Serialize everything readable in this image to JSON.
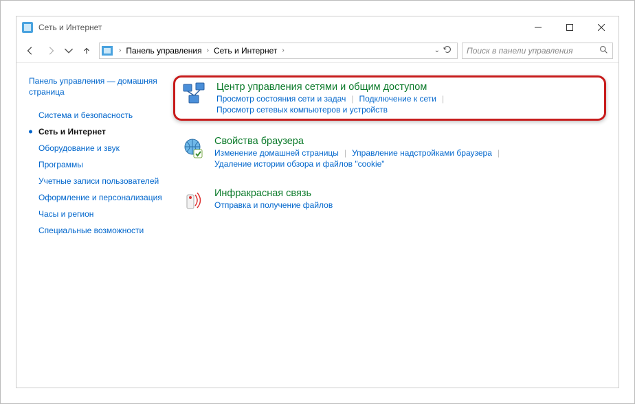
{
  "window": {
    "title": "Сеть и Интернет"
  },
  "breadcrumb": {
    "root": "Панель управления",
    "current": "Сеть и Интернет"
  },
  "search": {
    "placeholder": "Поиск в панели управления"
  },
  "sidebar": {
    "heading": "Панель управления — домашняя страница",
    "items": [
      {
        "label": "Система и безопасность",
        "current": false
      },
      {
        "label": "Сеть и Интернет",
        "current": true
      },
      {
        "label": "Оборудование и звук",
        "current": false
      },
      {
        "label": "Программы",
        "current": false
      },
      {
        "label": "Учетные записи пользователей",
        "current": false
      },
      {
        "label": "Оформление и персонализация",
        "current": false
      },
      {
        "label": "Часы и регион",
        "current": false
      },
      {
        "label": "Специальные возможности",
        "current": false
      }
    ]
  },
  "categories": [
    {
      "title": "Центр управления сетями и общим доступом",
      "links": [
        "Просмотр состояния сети и задач",
        "Подключение к сети",
        "Просмотр сетевых компьютеров и устройств"
      ],
      "highlight": true
    },
    {
      "title": "Свойства браузера",
      "links": [
        "Изменение домашней страницы",
        "Управление надстройками браузера",
        "Удаление истории обзора и файлов \"cookie\""
      ],
      "highlight": false
    },
    {
      "title": "Инфракрасная связь",
      "links": [
        "Отправка и получение файлов"
      ],
      "highlight": false
    }
  ]
}
